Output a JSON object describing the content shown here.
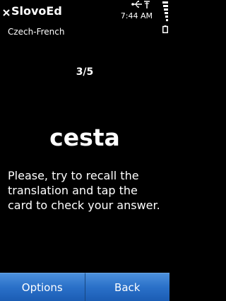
{
  "app": {
    "title": "SlovoEd",
    "subtitle": "Czech-French"
  },
  "status": {
    "time": "7:44 AM"
  },
  "card": {
    "progress": "3/5",
    "word": "cesta",
    "instruction": "Please, try to recall the translation and tap the card to check your answer."
  },
  "softkeys": {
    "left": "Options",
    "right": "Back"
  },
  "icons": {
    "close": "close-icon",
    "usb": "usb-icon",
    "connection": "connection-icon",
    "signal": "signal-bars-icon",
    "battery": "battery-icon"
  }
}
